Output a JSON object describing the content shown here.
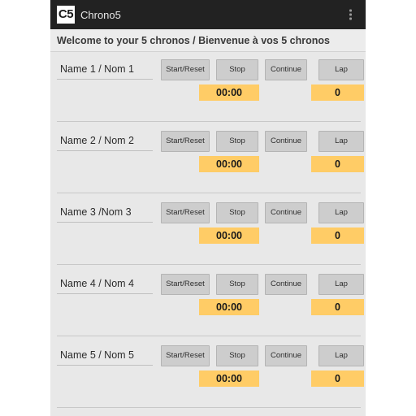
{
  "action_bar": {
    "logo_text": "C5",
    "title": "Chrono5",
    "overflow_label": "more-options"
  },
  "banner": {
    "welcome_text": "Welcome to your 5 chronos / Bienvenue à vos 5 chronos"
  },
  "colors": {
    "accent_yellow": "#FFCC66",
    "action_bar_bg": "#222222",
    "body_bg": "#E8E8E8",
    "button_bg": "#CDCDCD"
  },
  "buttons": {
    "start_reset": "Start/Reset",
    "stop": "Stop",
    "continue": "Continue",
    "lap": "Lap"
  },
  "chronos": [
    {
      "name_value": "Name 1 / Nom 1",
      "name_placeholder": "Name 1 / Nom 1",
      "timer": "00:00",
      "lap_count": "0"
    },
    {
      "name_value": "Name 2 / Nom 2",
      "name_placeholder": "Name 2 / Nom 2",
      "timer": "00:00",
      "lap_count": "0"
    },
    {
      "name_value": "Name 3 /Nom 3",
      "name_placeholder": "Name 3 /Nom 3",
      "timer": "00:00",
      "lap_count": "0"
    },
    {
      "name_value": "Name 4 / Nom 4",
      "name_placeholder": "Name 4 / Nom 4",
      "timer": "00:00",
      "lap_count": "0"
    },
    {
      "name_value": "Name 5 / Nom 5",
      "name_placeholder": "Name 5 / Nom 5",
      "timer": "00:00",
      "lap_count": "0"
    }
  ]
}
